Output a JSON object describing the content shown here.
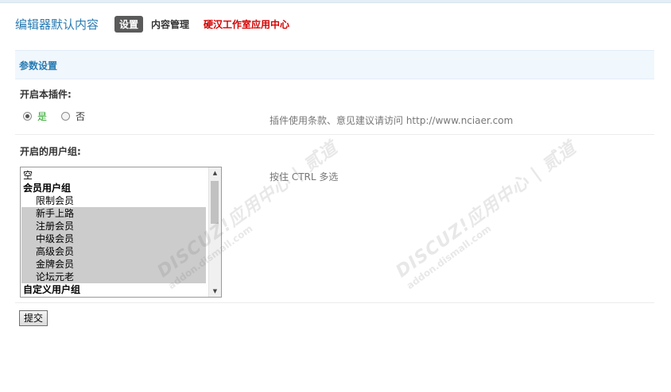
{
  "header": {
    "title": "编辑器默认内容",
    "tabs": [
      {
        "label": "设置",
        "active": true
      },
      {
        "label": "内容管理",
        "active": false
      },
      {
        "label": "硬汉工作室应用中心",
        "active": false,
        "color": "#d40000"
      }
    ]
  },
  "section": {
    "title": "参数设置"
  },
  "plugin_enable": {
    "label": "开启本插件:",
    "options": [
      {
        "label": "是",
        "checked": true
      },
      {
        "label": "否",
        "checked": false
      }
    ],
    "hint": "插件使用条款、意见建议请访问 http://www.nciaer.com"
  },
  "user_groups": {
    "label": "开启的用户组:",
    "hint": "按住 CTRL 多选",
    "options": [
      {
        "label": "空",
        "type": "first",
        "selected": false
      },
      {
        "label": "会员用户组",
        "type": "group",
        "selected": false
      },
      {
        "label": "限制会员",
        "type": "child",
        "selected": false
      },
      {
        "label": "新手上路",
        "type": "child",
        "selected": true
      },
      {
        "label": "注册会员",
        "type": "child",
        "selected": true
      },
      {
        "label": "中级会员",
        "type": "child",
        "selected": true
      },
      {
        "label": "高级会员",
        "type": "child",
        "selected": true
      },
      {
        "label": "金牌会员",
        "type": "child",
        "selected": true
      },
      {
        "label": "论坛元老",
        "type": "child",
        "selected": true
      },
      {
        "label": "自定义用户组",
        "type": "group",
        "selected": false
      }
    ]
  },
  "submit_label": "提交",
  "watermark": {
    "main": "DISCUZ!应用中心 | 贰道",
    "sub": "addon.dismall.com"
  },
  "colors": {
    "accent": "#2b7cb3",
    "active_tab_bg": "#5a5a5a",
    "link_red": "#d40000",
    "yes_green": "#22a322",
    "section_bg": "#f0f7fd"
  },
  "icons": {
    "scroll_up": "▲",
    "scroll_down": "▼"
  }
}
